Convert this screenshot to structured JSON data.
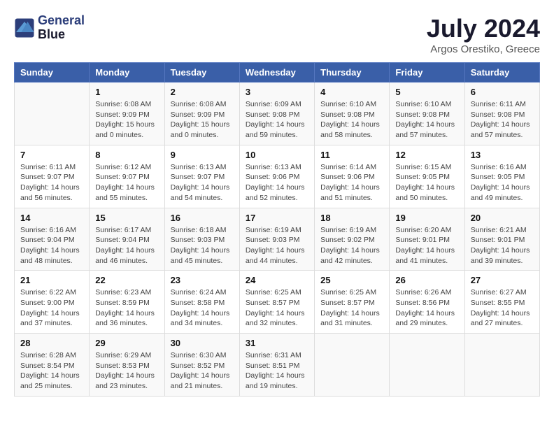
{
  "header": {
    "logo_line1": "General",
    "logo_line2": "Blue",
    "month": "July 2024",
    "location": "Argos Orestiko, Greece"
  },
  "weekdays": [
    "Sunday",
    "Monday",
    "Tuesday",
    "Wednesday",
    "Thursday",
    "Friday",
    "Saturday"
  ],
  "weeks": [
    [
      {
        "day": "",
        "info": ""
      },
      {
        "day": "1",
        "info": "Sunrise: 6:08 AM\nSunset: 9:09 PM\nDaylight: 15 hours\nand 0 minutes."
      },
      {
        "day": "2",
        "info": "Sunrise: 6:08 AM\nSunset: 9:09 PM\nDaylight: 15 hours\nand 0 minutes."
      },
      {
        "day": "3",
        "info": "Sunrise: 6:09 AM\nSunset: 9:08 PM\nDaylight: 14 hours\nand 59 minutes."
      },
      {
        "day": "4",
        "info": "Sunrise: 6:10 AM\nSunset: 9:08 PM\nDaylight: 14 hours\nand 58 minutes."
      },
      {
        "day": "5",
        "info": "Sunrise: 6:10 AM\nSunset: 9:08 PM\nDaylight: 14 hours\nand 57 minutes."
      },
      {
        "day": "6",
        "info": "Sunrise: 6:11 AM\nSunset: 9:08 PM\nDaylight: 14 hours\nand 57 minutes."
      }
    ],
    [
      {
        "day": "7",
        "info": "Sunrise: 6:11 AM\nSunset: 9:07 PM\nDaylight: 14 hours\nand 56 minutes."
      },
      {
        "day": "8",
        "info": "Sunrise: 6:12 AM\nSunset: 9:07 PM\nDaylight: 14 hours\nand 55 minutes."
      },
      {
        "day": "9",
        "info": "Sunrise: 6:13 AM\nSunset: 9:07 PM\nDaylight: 14 hours\nand 54 minutes."
      },
      {
        "day": "10",
        "info": "Sunrise: 6:13 AM\nSunset: 9:06 PM\nDaylight: 14 hours\nand 52 minutes."
      },
      {
        "day": "11",
        "info": "Sunrise: 6:14 AM\nSunset: 9:06 PM\nDaylight: 14 hours\nand 51 minutes."
      },
      {
        "day": "12",
        "info": "Sunrise: 6:15 AM\nSunset: 9:05 PM\nDaylight: 14 hours\nand 50 minutes."
      },
      {
        "day": "13",
        "info": "Sunrise: 6:16 AM\nSunset: 9:05 PM\nDaylight: 14 hours\nand 49 minutes."
      }
    ],
    [
      {
        "day": "14",
        "info": "Sunrise: 6:16 AM\nSunset: 9:04 PM\nDaylight: 14 hours\nand 48 minutes."
      },
      {
        "day": "15",
        "info": "Sunrise: 6:17 AM\nSunset: 9:04 PM\nDaylight: 14 hours\nand 46 minutes."
      },
      {
        "day": "16",
        "info": "Sunrise: 6:18 AM\nSunset: 9:03 PM\nDaylight: 14 hours\nand 45 minutes."
      },
      {
        "day": "17",
        "info": "Sunrise: 6:19 AM\nSunset: 9:03 PM\nDaylight: 14 hours\nand 44 minutes."
      },
      {
        "day": "18",
        "info": "Sunrise: 6:19 AM\nSunset: 9:02 PM\nDaylight: 14 hours\nand 42 minutes."
      },
      {
        "day": "19",
        "info": "Sunrise: 6:20 AM\nSunset: 9:01 PM\nDaylight: 14 hours\nand 41 minutes."
      },
      {
        "day": "20",
        "info": "Sunrise: 6:21 AM\nSunset: 9:01 PM\nDaylight: 14 hours\nand 39 minutes."
      }
    ],
    [
      {
        "day": "21",
        "info": "Sunrise: 6:22 AM\nSunset: 9:00 PM\nDaylight: 14 hours\nand 37 minutes."
      },
      {
        "day": "22",
        "info": "Sunrise: 6:23 AM\nSunset: 8:59 PM\nDaylight: 14 hours\nand 36 minutes."
      },
      {
        "day": "23",
        "info": "Sunrise: 6:24 AM\nSunset: 8:58 PM\nDaylight: 14 hours\nand 34 minutes."
      },
      {
        "day": "24",
        "info": "Sunrise: 6:25 AM\nSunset: 8:57 PM\nDaylight: 14 hours\nand 32 minutes."
      },
      {
        "day": "25",
        "info": "Sunrise: 6:25 AM\nSunset: 8:57 PM\nDaylight: 14 hours\nand 31 minutes."
      },
      {
        "day": "26",
        "info": "Sunrise: 6:26 AM\nSunset: 8:56 PM\nDaylight: 14 hours\nand 29 minutes."
      },
      {
        "day": "27",
        "info": "Sunrise: 6:27 AM\nSunset: 8:55 PM\nDaylight: 14 hours\nand 27 minutes."
      }
    ],
    [
      {
        "day": "28",
        "info": "Sunrise: 6:28 AM\nSunset: 8:54 PM\nDaylight: 14 hours\nand 25 minutes."
      },
      {
        "day": "29",
        "info": "Sunrise: 6:29 AM\nSunset: 8:53 PM\nDaylight: 14 hours\nand 23 minutes."
      },
      {
        "day": "30",
        "info": "Sunrise: 6:30 AM\nSunset: 8:52 PM\nDaylight: 14 hours\nand 21 minutes."
      },
      {
        "day": "31",
        "info": "Sunrise: 6:31 AM\nSunset: 8:51 PM\nDaylight: 14 hours\nand 19 minutes."
      },
      {
        "day": "",
        "info": ""
      },
      {
        "day": "",
        "info": ""
      },
      {
        "day": "",
        "info": ""
      }
    ]
  ]
}
